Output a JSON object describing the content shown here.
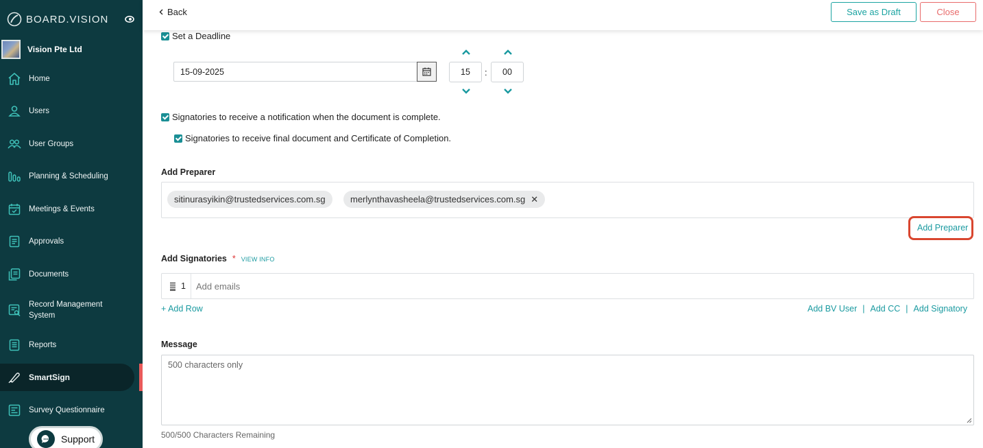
{
  "app": {
    "brand": "BOARD.VISION",
    "org_name": "Vision Pte Ltd"
  },
  "sidebar": {
    "items": [
      {
        "label": "Home",
        "icon": "home-icon"
      },
      {
        "label": "Users",
        "icon": "user-icon"
      },
      {
        "label": "User Groups",
        "icon": "users-icon"
      },
      {
        "label": "Planning & Scheduling",
        "icon": "bars-icon"
      },
      {
        "label": "Meetings & Events",
        "icon": "calendar-check-icon"
      },
      {
        "label": "Approvals",
        "icon": "document-icon"
      },
      {
        "label": "Documents",
        "icon": "documents-icon"
      },
      {
        "label": "Record Management System",
        "icon": "record-icon"
      },
      {
        "label": "Reports",
        "icon": "report-icon"
      },
      {
        "label": "SmartSign",
        "icon": "pen-icon",
        "active": true
      },
      {
        "label": "Survey Questionnaire",
        "icon": "survey-icon"
      }
    ],
    "support_label": "Support"
  },
  "header": {
    "back_label": "Back",
    "save_draft_label": "Save as Draft",
    "close_label": "Close"
  },
  "deadline": {
    "checkbox_label": "Set a Deadline",
    "date_value": "15-09-2025",
    "hour": "15",
    "minute": "00"
  },
  "notifications": {
    "notify_label": "Signatories to receive a notification when the document is complete.",
    "final_doc_label": "Signatories to receive final document and Certificate of Completion."
  },
  "preparer": {
    "title": "Add Preparer",
    "chips": [
      "sitinurasyikin@trustedservices.com.sg",
      "merlynthavasheela@trustedservices.com.sg"
    ],
    "add_link": "Add Preparer"
  },
  "signatories": {
    "title": "Add Signatories",
    "required_mark": "*",
    "view_info": "VIEW INFO",
    "row_number": "1",
    "email_placeholder": "Add emails",
    "add_row": "+ Add Row",
    "add_bv_user": "Add BV User",
    "add_cc": "Add CC",
    "add_signatory": "Add Signatory"
  },
  "message": {
    "title": "Message",
    "placeholder": "500 characters only",
    "remaining": "500/500 Characters Remaining"
  },
  "colors": {
    "sidebar_bg": "#0d3a40",
    "accent": "#1a9aa0",
    "danger": "#e86a6a"
  }
}
